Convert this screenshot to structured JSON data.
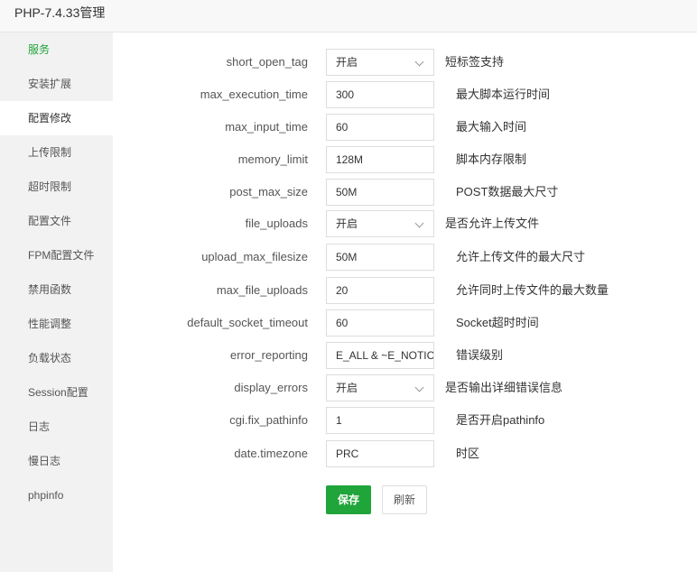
{
  "window": {
    "title": "PHP-7.4.33管理"
  },
  "sidebar": {
    "items": [
      {
        "label": "服务"
      },
      {
        "label": "安装扩展"
      },
      {
        "label": "配置修改"
      },
      {
        "label": "上传限制"
      },
      {
        "label": "超时限制"
      },
      {
        "label": "配置文件"
      },
      {
        "label": "FPM配置文件"
      },
      {
        "label": "禁用函数"
      },
      {
        "label": "性能调整"
      },
      {
        "label": "负载状态"
      },
      {
        "label": "Session配置"
      },
      {
        "label": "日志"
      },
      {
        "label": "慢日志"
      },
      {
        "label": "phpinfo"
      }
    ],
    "active_index": 0,
    "selected_index": 2
  },
  "settings": [
    {
      "name": "short_open_tag",
      "value": "开启",
      "desc": "短标签支持"
    },
    {
      "name": "max_execution_time",
      "value": "300",
      "desc": "最大脚本运行时间"
    },
    {
      "name": "max_input_time",
      "value": "60",
      "desc": "最大输入时间"
    },
    {
      "name": "memory_limit",
      "value": "128M",
      "desc": "脚本内存限制"
    },
    {
      "name": "post_max_size",
      "value": "50M",
      "desc": "POST数据最大尺寸"
    },
    {
      "name": "file_uploads",
      "value": "开启",
      "desc": "是否允许上传文件"
    },
    {
      "name": "upload_max_filesize",
      "value": "50M",
      "desc": "允许上传文件的最大尺寸"
    },
    {
      "name": "max_file_uploads",
      "value": "20",
      "desc": "允许同时上传文件的最大数量"
    },
    {
      "name": "default_socket_timeout",
      "value": "60",
      "desc": "Socket超时时间"
    },
    {
      "name": "error_reporting",
      "value": "E_ALL & ~E_NOTICE",
      "desc": "错误级别"
    },
    {
      "name": "display_errors",
      "value": "开启",
      "desc": "是否输出详细错误信息"
    },
    {
      "name": "cgi.fix_pathinfo",
      "value": "1",
      "desc": "是否开启pathinfo"
    },
    {
      "name": "date.timezone",
      "value": "PRC",
      "desc": "时区"
    }
  ],
  "buttons": {
    "save": "保存",
    "refresh": "刷新"
  },
  "colors": {
    "accent": "#20a53a",
    "sidebar_bg": "#f2f2f2"
  }
}
